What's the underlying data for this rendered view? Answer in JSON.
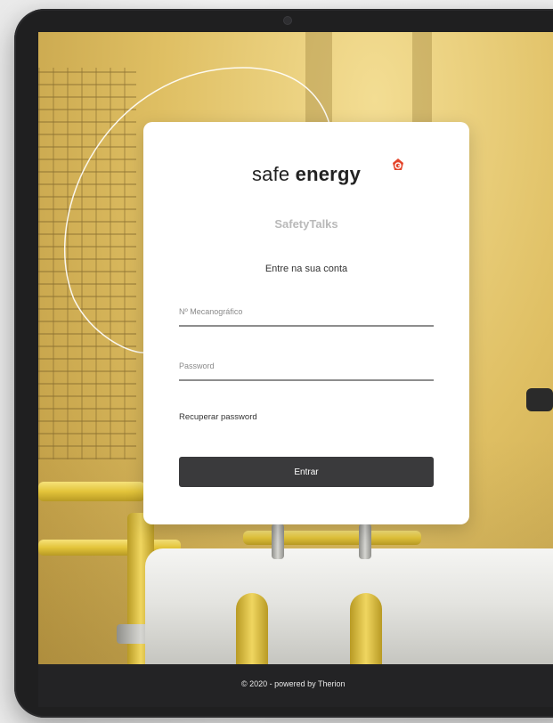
{
  "brand": {
    "name_light": "safe",
    "name_bold": "energy",
    "accent_color": "#e4452b"
  },
  "app": {
    "product_name": "SafetyTalks"
  },
  "login": {
    "heading": "Entre na sua conta",
    "username_placeholder": "Nº Mecanográfico",
    "password_placeholder": "Password",
    "recover_link": "Recuperar password",
    "submit_label": "Entrar"
  },
  "footer": {
    "text": "© 2020 - powered by Therion"
  },
  "colors": {
    "button": "#3a3a3c",
    "footer": "#232325",
    "card": "#ffffff"
  }
}
